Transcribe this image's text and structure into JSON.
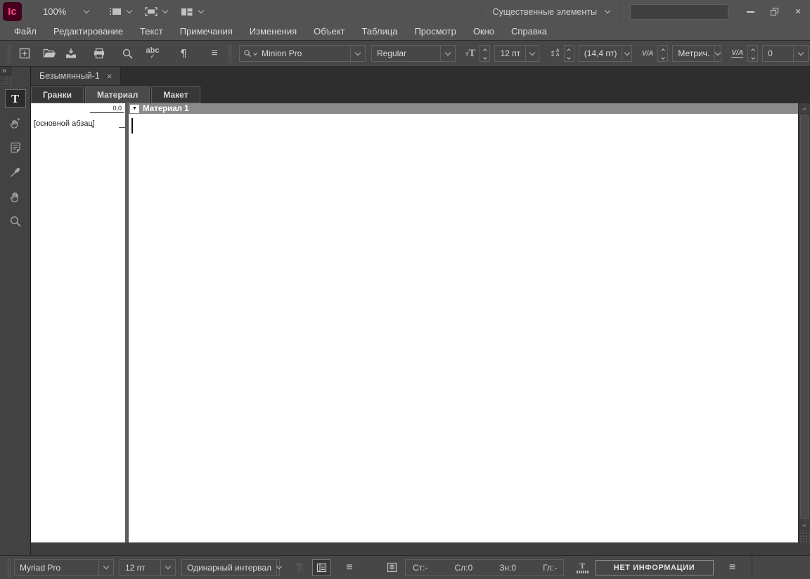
{
  "titlebar": {
    "logo_text": "Ic",
    "zoom_value": "100%",
    "workspace_label": "Существенные элементы",
    "search_value": ""
  },
  "menubar": {
    "items": [
      "Файл",
      "Редактирование",
      "Текст",
      "Примечания",
      "Изменения",
      "Объект",
      "Таблица",
      "Просмотр",
      "Окно",
      "Справка"
    ]
  },
  "toolbar": {
    "font_family": "Minion Pro",
    "font_style": "Regular",
    "font_size": "12 пт",
    "leading": "(14,4 пт)",
    "kerning": "Метрич.",
    "tracking": "0"
  },
  "document": {
    "tab_title": "Безымянный-1",
    "view_tabs": [
      {
        "label": "Гранки"
      },
      {
        "label": "Материал"
      },
      {
        "label": "Макет"
      }
    ],
    "story_title": "Материал 1",
    "paragraph_style": "[основной абзац]",
    "depth_ruler": "0,0"
  },
  "statusbar": {
    "font_family": "Myriad Pro",
    "font_size": "12 пт",
    "line_spacing": "Одинарный интервал",
    "stats": {
      "lines": "Ст:-",
      "words": "Сл:0",
      "characters": "Зн:0",
      "depth": "Гл:-"
    },
    "copyfit_status": "НЕТ ИНФОРМАЦИИ"
  },
  "icons": {
    "hamburger": "≡",
    "pilcrow": "¶",
    "spellcheck_text": "abc",
    "check": "✓",
    "expand_panel": "»",
    "tab_close": "×",
    "window_close": "×",
    "collapse_triangle": "▼",
    "updown_arrow": "↕",
    "size_icon_text": "T",
    "size_icon_small": "т",
    "kern_icon_text": "V/A",
    "track_icon_text": "V/A",
    "tool_type": "T"
  },
  "colors": {
    "accent_pink": "#ff4b82",
    "logo_bg": "#45001f",
    "story_header_gray": "#8a8a8a",
    "chrome_gray": "#535353",
    "panel_gray": "#474747"
  }
}
